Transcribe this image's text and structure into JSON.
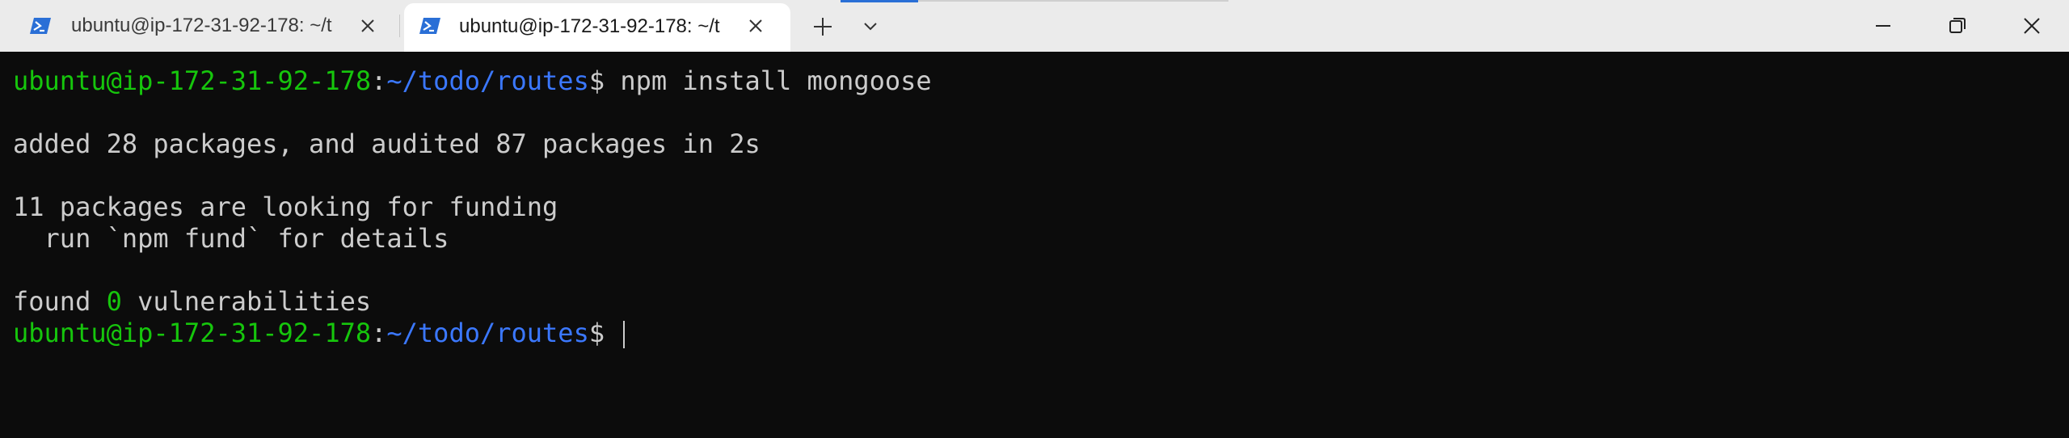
{
  "tabs": [
    {
      "title": "ubuntu@ip-172-31-92-178: ~/t",
      "active": false,
      "icon": "powershell-icon"
    },
    {
      "title": "ubuntu@ip-172-31-92-178: ~/t",
      "active": true,
      "icon": "powershell-icon"
    }
  ],
  "toolbar": {
    "new_tab_icon": "plus-icon",
    "dropdown_icon": "chevron-down-icon"
  },
  "window_controls": [
    "minimize-icon",
    "maximize-icon",
    "close-icon"
  ],
  "colors": {
    "terminal_bg": "#0c0c0c",
    "terminal_fg": "#cccccc",
    "prompt_user": "#16c60c",
    "prompt_path": "#3b78ff",
    "titlebar_bg": "#ebebeb",
    "tab_active_bg": "#ffffff",
    "progress": "#2a6fd6"
  },
  "terminal": {
    "prompt": {
      "user_host": "ubuntu@ip-172-31-92-178",
      "colon": ":",
      "path": "~/todo/routes",
      "symbol": "$"
    },
    "command": "npm install mongoose",
    "output": {
      "added": "added 28 packages, and audited 87 packages in 2s",
      "funding_line1": "11 packages are looking for funding",
      "funding_line2": "  run `npm fund` for details",
      "found_prefix": "found ",
      "found_count": "0",
      "found_suffix": " vulnerabilities"
    }
  }
}
